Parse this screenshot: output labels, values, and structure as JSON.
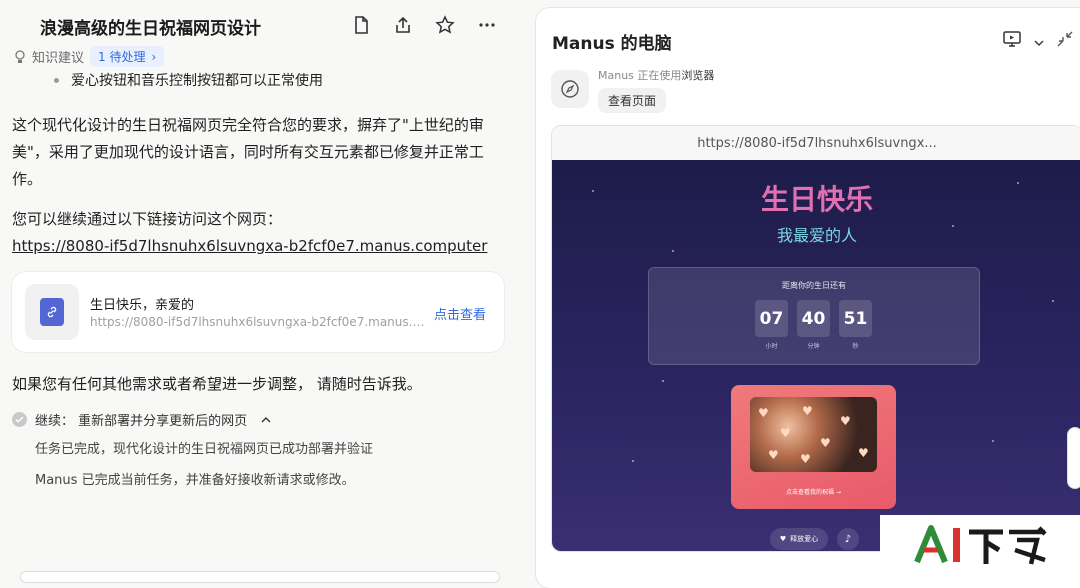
{
  "left": {
    "title": "浪漫高级的生日祝福网页设计",
    "kb_label": "知识建议",
    "pending_label": "1 待处理",
    "bullet": "爱心按钮和音乐控制按钮都可以正常使用",
    "para1_l1": "这个现代化设计的生日祝福网页完全符合您的要求，摒弃了\"上世纪的审",
    "para1_l2": "美\"，采用了更加现代的设计语言，同时所有交互元素都已修复并正常工",
    "para1_l3": "作。",
    "para2": "您可以继续通过以下链接访问这个网页：",
    "link": "https://8080-if5d7lhsnuhx6lsuvngxa-b2fcf0e7.manus.computer",
    "card": {
      "title": "生日快乐，亲爱的",
      "url": "https://8080-if5d7lhsnuhx6lsuvngxa-b2fcf0e7.manus.computer",
      "action": "点击查看"
    },
    "para3": "如果您有任何其他需求或者希望进一步调整， 请随时告诉我。",
    "task": "继续：  重新部署并分享更新后的网页",
    "done1": "任务已完成，现代化设计的生日祝福网页已成功部署并验证",
    "done2": "Manus 已完成当前任务，并准备好接收新请求或修改。"
  },
  "right": {
    "title": "Manus 的电脑",
    "status_prefix": "Manus 正在使用",
    "status_tool": "浏览器",
    "view_page": "查看页面",
    "url": "https://8080-if5d7lhsnuhx6lsuvngx...",
    "site": {
      "heading": "生日快乐",
      "subheading": "我最爱的人",
      "countdown_label": "距离你的生日还有",
      "hours": "07",
      "hours_unit": "小时",
      "minutes": "40",
      "minutes_unit": "分钟",
      "seconds": "51",
      "seconds_unit": "秒",
      "cta": "点击查看我的祝福 →",
      "release_love": "释放爱心",
      "music_icon": "♪"
    }
  },
  "watermark": {
    "text": "AI下载",
    "colors": [
      "#2e8b3a",
      "#d93030"
    ]
  }
}
